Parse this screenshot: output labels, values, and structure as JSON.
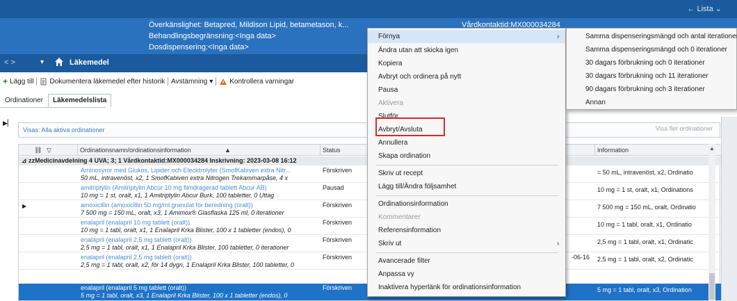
{
  "header": {
    "lista": "← Lista ⌄",
    "info_lines": [
      "Överkänslighet: Betapred, Mildison Lipid, betametason, k...",
      "Behandlingsbegränsning:<Inga data>",
      "Dosdispensering:<Inga data>"
    ],
    "vardkontakt": "Vårdkontaktid:MX000034284"
  },
  "modbar": {
    "nav": "<  >",
    "caret": "▾",
    "title": "Läkemedel"
  },
  "toolbar": {
    "add": "Lägg till",
    "document": "Dokumentera läkemedel efter historik",
    "reconcile": "Avstämning",
    "check": "Kontrollera varningar"
  },
  "tabs": [
    "Ordinationer",
    "Läkemedelslista"
  ],
  "filter": {
    "text": "Visas: Alla aktiva ordinationer",
    "more": "Visa fler ordinationer"
  },
  "grid": {
    "headers": {
      "name": "Ordinationsnamn/ordinationsinformation",
      "status": "Status",
      "info": "Information"
    },
    "group": "zzMedicinavdelning 4 UVA; 3; 1  Vårdkontaktid:MX000034284  Inskrivning: 2023-03-08 16:12",
    "rows": [
      {
        "l1": "Aminosyror med Glukos, Lipider och Elecktrolyter (SmofKabiven extra Nitr...",
        "l2": "50 mL, intravenöst, x2, 1 SmofKabiven extra Nitrogen Trekammarpåse, 4 x",
        "status": "Förskriven",
        "date": "",
        "info": "= 50 mL, intravenöst, x2, Ordinatio",
        "pointer": ""
      },
      {
        "l1": "amitriptylin (Amitriptylin Abcur 10 mg filmdragerad tablett Abcur AB)",
        "l2": "10 mg = 1 st, oralt, x1, 1 Amitriptylin Abcur Burk, 100 tabletter, 0 Uttag",
        "status": "Pausad",
        "date": "",
        "info": "10 mg = 1 st, oralt, x1, Ordinations",
        "pointer": ""
      },
      {
        "l1": "amoxicillin (amoxicillin 50 mg/ml granulat för beredning (oralt))",
        "l2": "7 500 mg = 150 mL, oralt, x3, 1 Amimox® Glasflaska 125 ml, 0 iterationer",
        "status": "Förskriven",
        "date": "",
        "info": "7 500 mg = 150 mL, oralt, Ordinatio",
        "pointer": "▶"
      },
      {
        "l1": "enalapril (enalapril 10 mg tablett (oralt))",
        "l2": "10 mg = 1 tabl, oralt, x1, 1 Enalapril Krka Blister, 100 x 1 tabletter (endos), 0",
        "status": "Förskriven",
        "date": "",
        "info": "10 mg = 1 tabl, oralt, x1, Ordinatio",
        "pointer": ""
      },
      {
        "l1": "enalapril (enalapril 2,5 mg tablett (oralt))",
        "l2": "2,5 mg = 1 tabl, oralt, x1, 1 Enalapril Krka Blister, 100 tabletter, 0 iterationer",
        "status": "Förskriven",
        "date": "",
        "info": "2,5 mg = 1 tabl, oralt, x1, Ordinatic",
        "pointer": ""
      },
      {
        "l1": "enalapril (enalapril 2,5 mg tablett (oralt))",
        "l2": "2,5 mg = 1 tabl, oralt, x2, för 14 dygn, 1 Enalapril Krka Blister, 100 tabletter, 0",
        "status": "Förskriven",
        "date": "-06-16",
        "info": "2.5 mg = 1 tabl, oralt, x2, Ordinatic",
        "pointer": ""
      },
      {
        "l1": "enalapril (enalapril 5 mg tablett (oralt))",
        "l2": "5 mg = 1 tabl, oralt, x3, 1 Enalapril Krka Blister, 100 x 1 tabletter (endos), 0",
        "status": "Förskriven",
        "date": "",
        "info": "5 mg = 1 tabl, oralt, x3, Ordination",
        "pointer": ""
      }
    ]
  },
  "context_menu": {
    "items": [
      {
        "label": "Förnya",
        "arrow": "›",
        "highlight": true
      },
      {
        "label": "Ändra utan att skicka igen"
      },
      {
        "label": "Kopiera"
      },
      {
        "label": "Avbryt och ordinera på nytt"
      },
      {
        "label": "Pausa"
      },
      {
        "label": "Aktivera",
        "disabled": true
      },
      {
        "label": "Slutför"
      },
      {
        "label": "Avbryt/Avsluta"
      },
      {
        "label": "Annullera"
      },
      {
        "label": "Skapa ordination"
      },
      {
        "label": "Skriv ut recept"
      },
      {
        "label": "Lägg till/Ändra följsamhet"
      },
      {
        "label": "Ordinationsinformation"
      },
      {
        "label": "Kommentarer",
        "disabled": true
      },
      {
        "label": "Referensinformation"
      },
      {
        "label": "Skriv ut",
        "arrow": "›"
      },
      {
        "label": "Avancerade filter"
      },
      {
        "label": "Anpassa vy"
      },
      {
        "label": "Inaktivera hyperlänk för ordinationsinformation"
      }
    ]
  },
  "submenu": {
    "items": [
      "Samma dispenseringsmängd och antal iterationer",
      "Samma dispenseringsmängd och 0 iterationer",
      "30 dagars förbrukning och 0 iterationer",
      "30 dagars förbrukning och 11 iterationer",
      "90 dagars förbrukning och 3 iterationer",
      "Annan"
    ]
  },
  "colors": {
    "header_dark": "#1b5a9c",
    "header_light": "#2a72bd",
    "selection": "#1e72c8",
    "highlight_box": "#d9282c"
  }
}
